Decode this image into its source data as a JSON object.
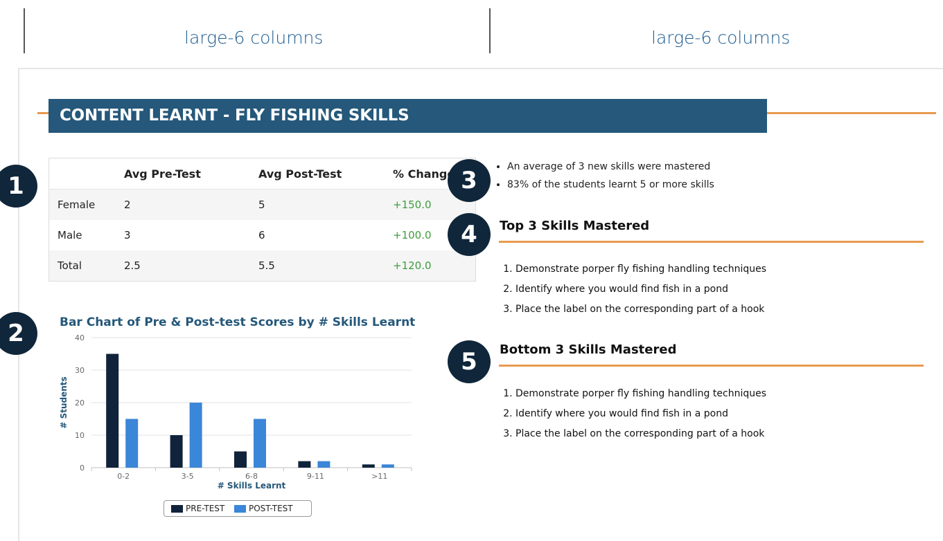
{
  "columns": [
    "large-6 columns",
    "large-6 columns"
  ],
  "banner": {
    "title": "CONTENT LEARNT - FLY FISHING SKILLS"
  },
  "badges": [
    "1",
    "2",
    "3",
    "4",
    "5"
  ],
  "table": {
    "headers": [
      "",
      "Avg Pre-Test",
      "Avg Post-Test",
      "% Change"
    ],
    "rows": [
      [
        "Female",
        "2",
        "5",
        "+150.0"
      ],
      [
        "Male",
        "3",
        "6",
        "+100.0"
      ],
      [
        "Total",
        "2.5",
        "5.5",
        "+120.0"
      ]
    ]
  },
  "bullets": [
    "An average of 3 new skills were mastered",
    "83% of the students learnt 5 or more skills"
  ],
  "top_skills": {
    "title": "Top 3 Skills Mastered",
    "items": [
      "Demonstrate porper fly fishing handling techniques",
      "Identify where you would find fish in a pond",
      "Place the label on the corresponding part of a hook"
    ]
  },
  "bottom_skills": {
    "title": "Bottom 3 Skills Mastered",
    "items": [
      "Demonstrate porper fly fishing handling techniques",
      "Identify where you would find fish in a pond",
      "Place the label on the corresponding part of a hook"
    ]
  },
  "colors": {
    "banner": "#25587a",
    "accent_rule": "#e89a4e",
    "badge": "#10263a",
    "positive_change": "#3c9e3c",
    "pre_test": "#10233a",
    "post_test": "#3a86d8"
  },
  "chart_data": {
    "type": "bar",
    "title": "Bar Chart of Pre & Post-test Scores by # Skills Learnt",
    "xlabel": "# Skills Learnt",
    "ylabel": "# Students",
    "categories": [
      "0-2",
      "3-5",
      "6-8",
      "9-11",
      ">11"
    ],
    "series": [
      {
        "name": "PRE-TEST",
        "values": [
          35,
          10,
          5,
          2,
          1
        ]
      },
      {
        "name": "POST-TEST",
        "values": [
          15,
          20,
          15,
          2,
          1
        ]
      }
    ],
    "ylim": [
      0,
      40
    ],
    "yticks": [
      0,
      10,
      20,
      30,
      40
    ],
    "grid": true,
    "legend": "bottom-center"
  }
}
